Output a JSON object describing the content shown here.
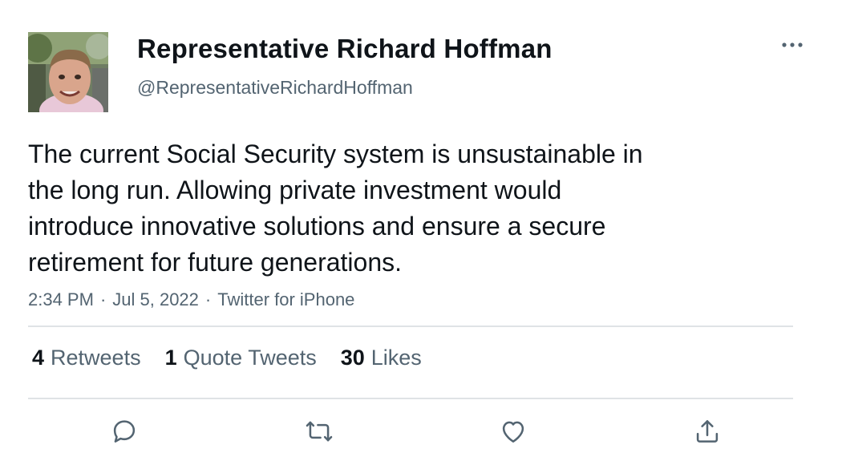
{
  "author": {
    "display_name": "Representative Richard Hoffman",
    "handle": "@RepresentativeRichardHoffman"
  },
  "tweet": {
    "text": "The current Social Security system is unsustainable in\nthe long run. Allowing private investment would\nintroduce innovative solutions and ensure a secure\nretirement for future generations.",
    "time": "2:34 PM",
    "date": "Jul 5, 2022",
    "source": "Twitter for iPhone",
    "separator": "·"
  },
  "stats": {
    "retweets": {
      "count": "4",
      "label": "Retweets"
    },
    "quotes": {
      "count": "1",
      "label": "Quote Tweets"
    },
    "likes": {
      "count": "30",
      "label": "Likes"
    }
  },
  "icons": {
    "more": "more-horizontal-icon",
    "reply": "reply-icon",
    "retweet": "retweet-icon",
    "like": "heart-icon",
    "share": "share-icon"
  },
  "colors": {
    "text_primary": "#0f1419",
    "text_secondary": "#536471",
    "divider": "#dfe3e6",
    "icon": "#536471"
  }
}
